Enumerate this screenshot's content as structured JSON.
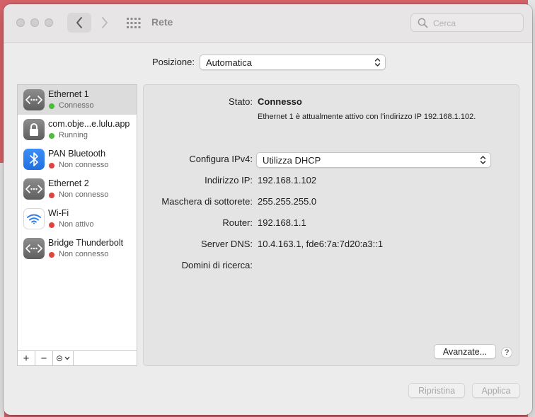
{
  "window": {
    "title": "Rete"
  },
  "search": {
    "placeholder": "Cerca"
  },
  "location": {
    "label": "Posizione:",
    "value": "Automatica"
  },
  "services": [
    {
      "name": "Ethernet 1",
      "status": "Connesso",
      "status_color": "#4cbb3a",
      "icon": "ethernet-icon",
      "selected": true
    },
    {
      "name": "com.obje...e.lulu.app",
      "status": "Running",
      "status_color": "#4cbb3a",
      "icon": "lock-icon",
      "selected": false
    },
    {
      "name": "PAN Bluetooth",
      "status": "Non connesso",
      "status_color": "#e0443e",
      "icon": "bluetooth-icon",
      "selected": false
    },
    {
      "name": "Ethernet 2",
      "status": "Non connesso",
      "status_color": "#e0443e",
      "icon": "ethernet-icon",
      "selected": false
    },
    {
      "name": "Wi-Fi",
      "status": "Non attivo",
      "status_color": "#e0443e",
      "icon": "wifi-icon",
      "selected": false
    },
    {
      "name": "Bridge Thunderbolt",
      "status": "Non connesso",
      "status_color": "#e0443e",
      "icon": "ethernet-icon",
      "selected": false
    }
  ],
  "toolbar": {
    "add": "+",
    "remove": "−",
    "actions": "⊝"
  },
  "detail": {
    "status_label": "Stato:",
    "status_value": "Connesso",
    "status_description": "Ethernet 1 è attualmente attivo con l'indirizzo IP 192.168.1.102.",
    "configure_label": "Configura IPv4:",
    "configure_value": "Utilizza DHCP",
    "ip_label": "Indirizzo IP:",
    "ip_value": "192.168.1.102",
    "subnet_label": "Maschera di sottorete:",
    "subnet_value": "255.255.255.0",
    "router_label": "Router:",
    "router_value": "192.168.1.1",
    "dns_label": "Server DNS:",
    "dns_value": "10.4.163.1, fde6:7a:7d20:a3::1",
    "search_domains_label": "Domini di ricerca:",
    "search_domains_value": "",
    "advanced_button": "Avanzate...",
    "help_button": "?"
  },
  "footer": {
    "reset_button": "Ripristina",
    "apply_button": "Applica"
  }
}
